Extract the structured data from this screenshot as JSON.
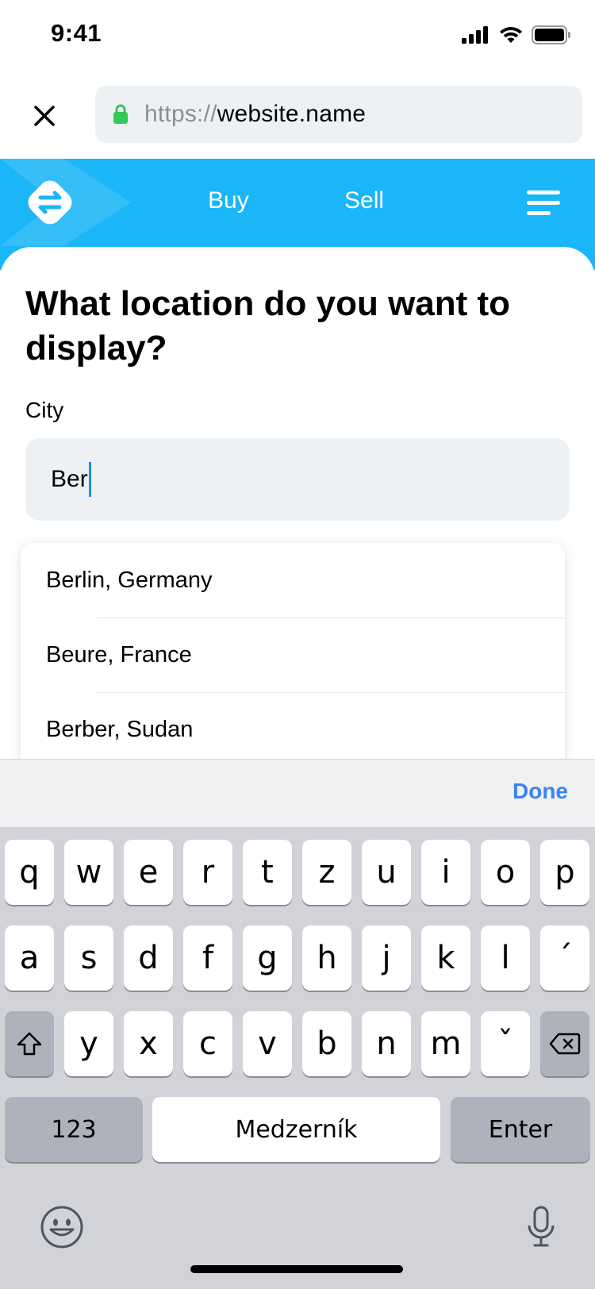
{
  "status_bar": {
    "time": "9:41"
  },
  "browser": {
    "url_protocol": "https://",
    "url_domain": "website.name"
  },
  "header": {
    "nav": [
      "Buy",
      "Sell"
    ]
  },
  "form": {
    "question": "What location do you want to display?",
    "city_label": "City",
    "city_value": "Ber"
  },
  "suggestions": [
    "Berlin, Germany",
    "Beure, France",
    "Berber, Sudan"
  ],
  "keyboard": {
    "done_label": "Done",
    "row1": [
      "q",
      "w",
      "e",
      "r",
      "t",
      "z",
      "u",
      "i",
      "o",
      "p"
    ],
    "row2": [
      "a",
      "s",
      "d",
      "f",
      "g",
      "h",
      "j",
      "k",
      "l",
      "´"
    ],
    "row3": [
      "y",
      "x",
      "c",
      "v",
      "b",
      "n",
      "m",
      "ˇ"
    ],
    "numbers_label": "123",
    "space_label": "Medzerník",
    "enter_label": "Enter"
  },
  "colors": {
    "brand": "#1ab6f8",
    "accent": "#3a82f7",
    "lock": "#34c759"
  }
}
